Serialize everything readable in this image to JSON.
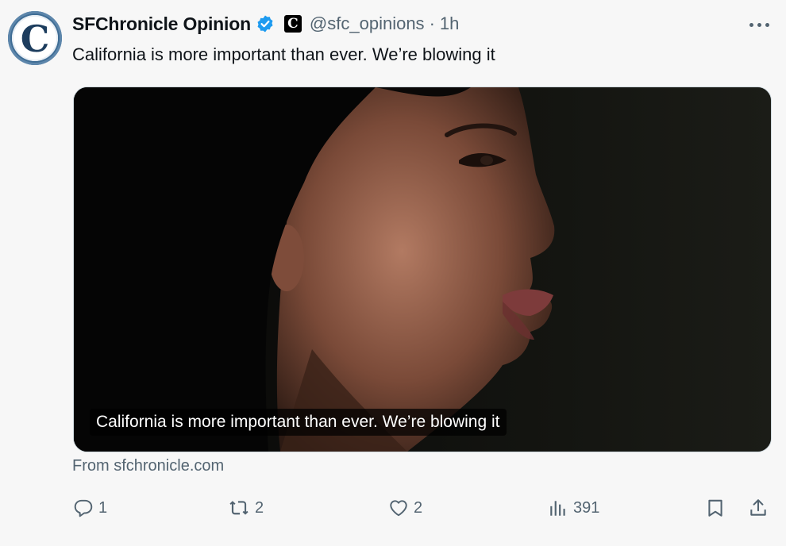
{
  "tweet": {
    "author_name": "SFChronicle Opinion",
    "handle": "@sfc_opinions",
    "separator": "·",
    "time": "1h",
    "text": "California is more important than ever. We’re blowing it"
  },
  "card": {
    "headline": "California is more important than ever. We’re blowing it",
    "source": "From sfchronicle.com"
  },
  "actions": {
    "replies": "1",
    "reposts": "2",
    "likes": "2",
    "views": "391"
  },
  "colors": {
    "verified": "#1d9bf0",
    "muted_text": "#536471",
    "avatar_blue": "#3f6d95"
  },
  "icons": [
    "verified-badge-icon",
    "affiliate-badge-icon",
    "more-icon",
    "reply-icon",
    "repost-icon",
    "like-icon",
    "views-icon",
    "bookmark-icon",
    "share-icon"
  ]
}
